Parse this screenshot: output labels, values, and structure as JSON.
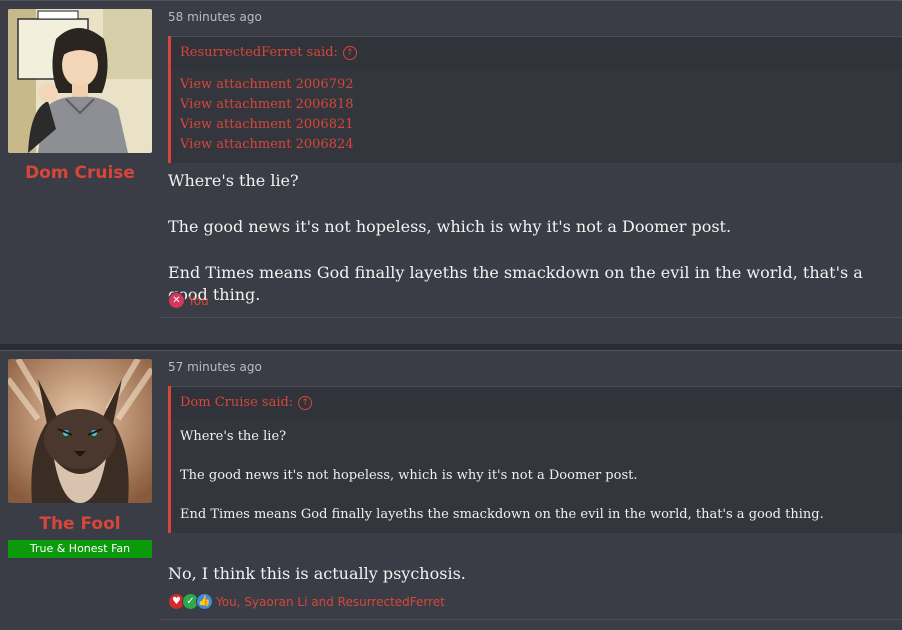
{
  "posts": [
    {
      "username": "Dom Cruise",
      "timestamp": "58 minutes ago",
      "quote": {
        "author_said": "ResurrectedFerret said:",
        "attachments": [
          "View attachment 2006792",
          "View attachment 2006818",
          "View attachment 2006821",
          "View attachment 2006824"
        ]
      },
      "message": [
        "Where's the lie?",
        "The good news it's not hopeless, which is why it's not a Doomer post.",
        "End Times means God finally layeths the smackdown on the evil in the world, that's a good thing."
      ],
      "reactions": {
        "icons": [
          "x-reaction-icon"
        ],
        "text": "You"
      }
    },
    {
      "username": "The Fool",
      "user_title": "True & Honest Fan",
      "timestamp": "57 minutes ago",
      "quote": {
        "author_said": "Dom Cruise said:",
        "lines": [
          "Where's the lie?",
          "The good news it's not hopeless, which is why it's not a Doomer post.",
          "End Times means God finally layeths the smackdown on the evil in the world, that's a good thing."
        ]
      },
      "message": [
        "No, I think this is actually psychosis."
      ],
      "reactions": {
        "icons": [
          "heart-reaction-icon",
          "check-reaction-icon",
          "thumbs-up-reaction-icon"
        ],
        "text": "You, Syaoran Li and ResurrectedFerret"
      }
    }
  ],
  "colors": {
    "accent": "#d8463a",
    "background": "#3a3d45",
    "title_badge": "#0a9a0a"
  }
}
